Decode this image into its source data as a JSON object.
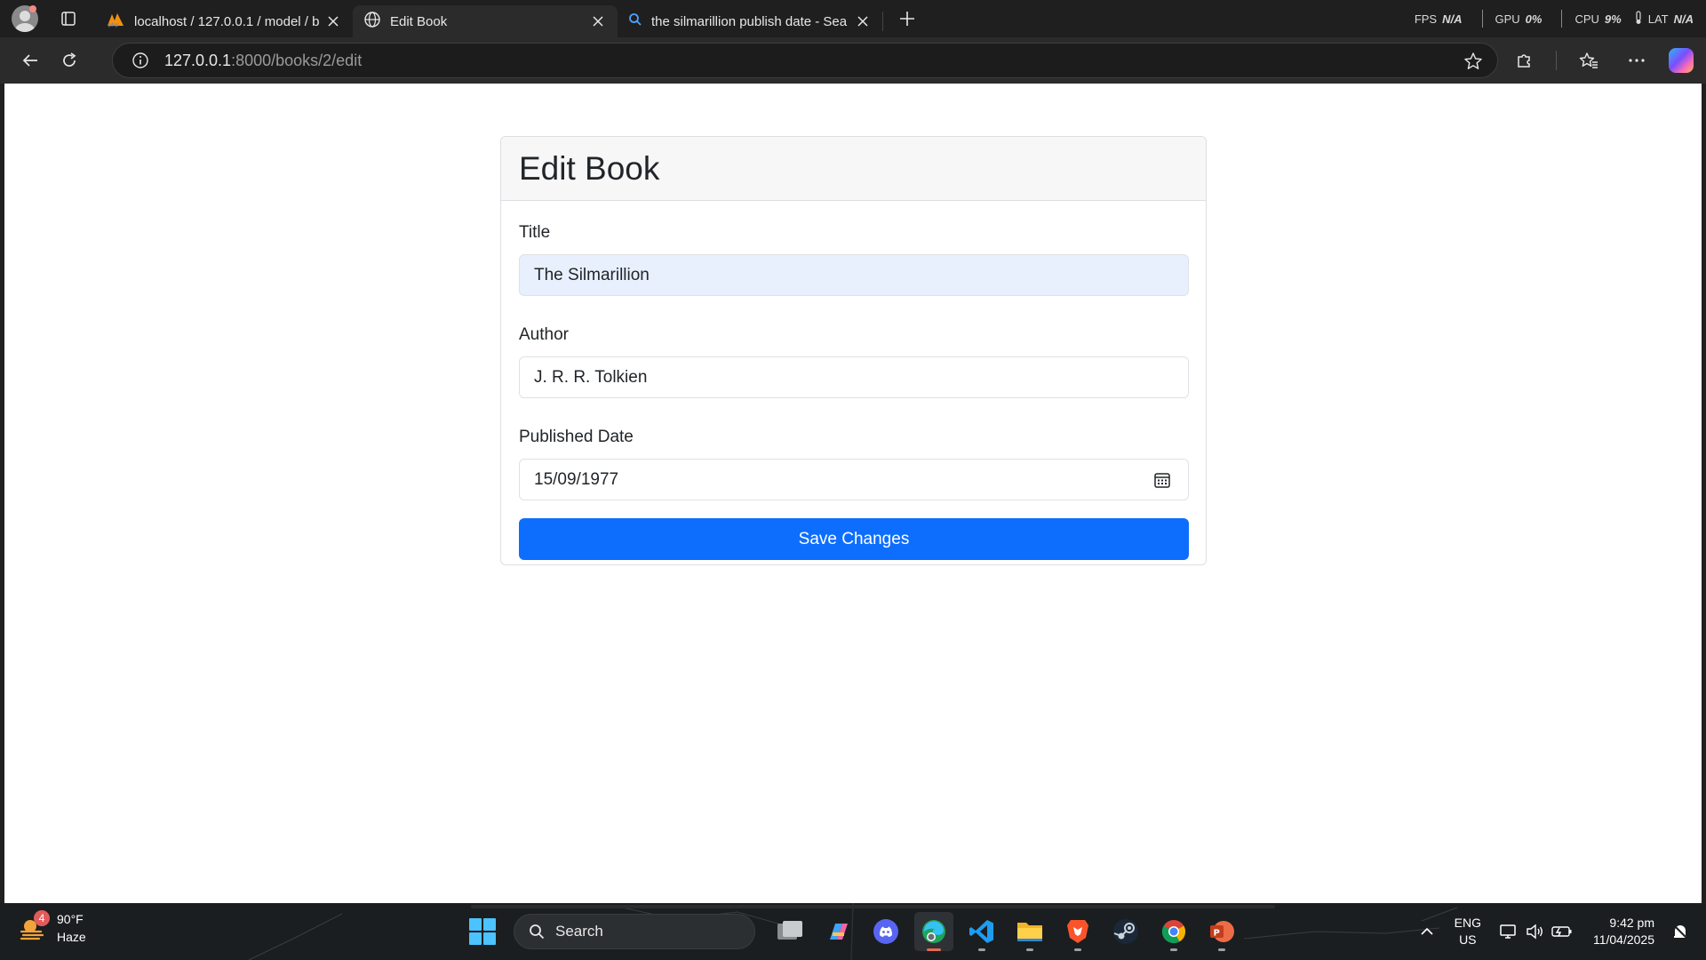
{
  "browser": {
    "tabs": [
      {
        "title": "localhost / 127.0.0.1 / model / bo",
        "icon": "phpmyadmin-icon",
        "active": false
      },
      {
        "title": "Edit Book",
        "icon": "globe-icon",
        "active": true
      },
      {
        "title": "the silmarillion publish date - Sea",
        "icon": "search-icon",
        "active": false
      }
    ],
    "perf": {
      "fps_label": "FPS",
      "fps_value": "N/A",
      "gpu_label": "GPU",
      "gpu_value": "0%",
      "cpu_label": "CPU",
      "cpu_value": "9%",
      "lat_label": "LAT",
      "lat_value": "N/A"
    },
    "address": {
      "host": "127.0.0.1",
      "rest": ":8000/books/2/edit"
    }
  },
  "page": {
    "heading": "Edit Book",
    "fields": {
      "title": {
        "label": "Title",
        "value": "The Silmarillion"
      },
      "author": {
        "label": "Author",
        "value": "J. R. R. Tolkien"
      },
      "published": {
        "label": "Published Date",
        "value": "15/09/1977"
      }
    },
    "submit_label": "Save Changes",
    "colors": {
      "primary": "#0d6efd",
      "autofill": "#e8f0fe"
    }
  },
  "taskbar": {
    "weather": {
      "temp": "90°F",
      "condition": "Haze",
      "badge": "4"
    },
    "search_placeholder": "Search",
    "apps": [
      "task-view",
      "copilot",
      "discord",
      "edge",
      "vscode",
      "file-explorer",
      "brave",
      "steam",
      "chrome",
      "powerpoint"
    ],
    "lang": {
      "line1": "ENG",
      "line2": "US"
    },
    "clock": {
      "time": "9:42 pm",
      "date": "11/04/2025"
    }
  }
}
